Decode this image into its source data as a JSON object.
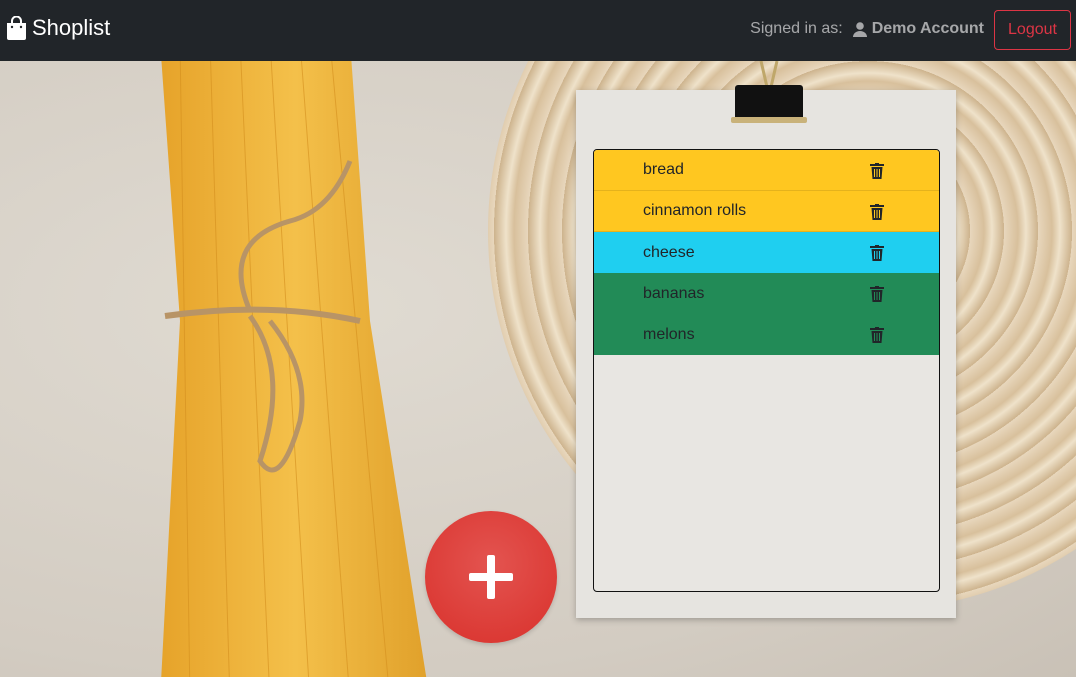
{
  "navbar": {
    "brand": "Shoplist",
    "brand_icon": "shopping-bag-icon",
    "signed_in_label": "Signed in as:",
    "account_name": "Demo Account",
    "logout_label": "Logout"
  },
  "list": {
    "items": [
      {
        "label": "bread",
        "variant": "warning"
      },
      {
        "label": "cinnamon rolls",
        "variant": "warning"
      },
      {
        "label": "cheese",
        "variant": "info"
      },
      {
        "label": "bananas",
        "variant": "success"
      },
      {
        "label": "melons",
        "variant": "success"
      }
    ],
    "delete_icon": "trash-icon"
  },
  "add_button": {
    "icon": "plus-icon"
  },
  "colors": {
    "navbar": "#212529",
    "danger": "#dc3545",
    "warning": "#ffc720",
    "info": "#1fcff0",
    "success": "#228b57"
  }
}
